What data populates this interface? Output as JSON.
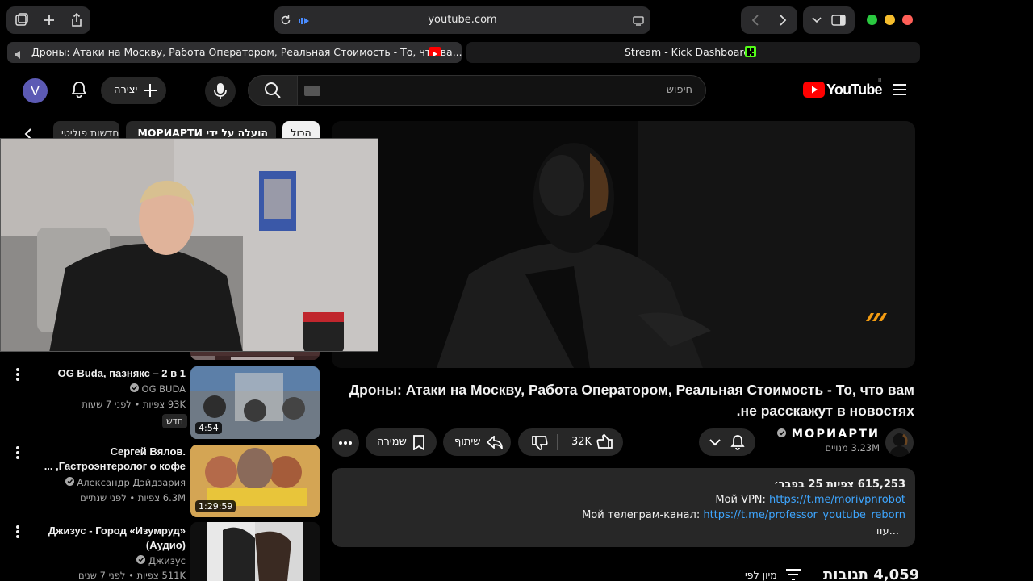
{
  "browser": {
    "url": "youtube.com",
    "tabs": [
      {
        "title": "Дроны: Атаки на Москву, Работа Оператором, Реальная Стоимость - То, что ва..."
      },
      {
        "title": "Stream - Kick Dashboard"
      }
    ]
  },
  "header": {
    "avatar_letter": "V",
    "create_label": "יצירה",
    "search_placeholder": "חיפוש",
    "logo_text": "YouTube",
    "logo_region": "IL"
  },
  "chips": [
    "הכול",
    "הועלה על ידי МОРИАРТИ",
    "חדשות פוליטי"
  ],
  "video": {
    "title": "Дроны: Атаки на Москву, Работа Оператором, Реальная Стоимость - То, что вам не расскажут в новостях.",
    "channel": "МОРИАРТИ",
    "subscribers": "3.23M מנויים",
    "likes": "32K",
    "share_label": "שיתוף",
    "save_label": "שמירה"
  },
  "description": {
    "stats": "615,253 צפיות  25 בפבר׳",
    "vpn_label": "Мой VPN: ",
    "vpn_link": "https://t.me/morivpnrobot",
    "tg_label": "Мой телеграм-канал: ",
    "tg_link": "https://t.me/professor_youtube_reborn",
    "more": "...עוד"
  },
  "comments": {
    "count": "4,059 תגובות",
    "sort_label": "מיון לפי"
  },
  "sidebar": [
    {
      "title": "OG Buda, пазнякс – 2 в 1",
      "channel": "OG BUDA",
      "meta": "93K צפיות • לפני 7 שעות",
      "badge": "חדש",
      "duration": "4:54"
    },
    {
      "title": "Сергей Вялов. Гастроэнтеролог о кофе, ...",
      "channel": "Александр Дэйдзария",
      "meta": "6.3M צפיות • לפני שנתיים",
      "duration": "1:29:59"
    },
    {
      "title": "Джизус - Город «Изумруд» (Аудио)",
      "channel": "Джизус",
      "meta": "511K צפיות • לפני 7 שנים"
    }
  ]
}
